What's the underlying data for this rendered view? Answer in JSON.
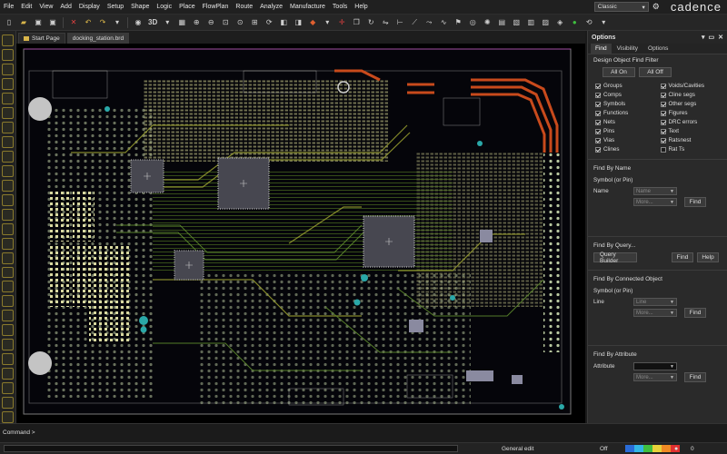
{
  "menubar": {
    "items": [
      "File",
      "Edit",
      "View",
      "Add",
      "Display",
      "Setup",
      "Shape",
      "Logic",
      "Place",
      "FlowPlan",
      "Route",
      "Analyze",
      "Manufacture",
      "Tools",
      "Help"
    ],
    "workspace": "Classic",
    "logo": "cadence"
  },
  "toolbar": {
    "view3d_label": "3D"
  },
  "tabs": [
    {
      "label": "Start Page"
    },
    {
      "label": "docking_station.brd"
    }
  ],
  "options": {
    "title": "Options",
    "tabs": [
      "Find",
      "Visibility",
      "Options"
    ],
    "filter": {
      "title": "Design Object Find Filter",
      "all_on": "All On",
      "all_off": "All Off",
      "left": [
        {
          "label": "Groups",
          "checked": true
        },
        {
          "label": "Comps",
          "checked": true
        },
        {
          "label": "Symbols",
          "checked": true
        },
        {
          "label": "Functions",
          "checked": true
        },
        {
          "label": "Nets",
          "checked": true
        },
        {
          "label": "Pins",
          "checked": true
        },
        {
          "label": "Vias",
          "checked": true
        },
        {
          "label": "Clines",
          "checked": true
        }
      ],
      "right": [
        {
          "label": "Voids/Cavities",
          "checked": true
        },
        {
          "label": "Cline segs",
          "checked": true
        },
        {
          "label": "Other segs",
          "checked": true
        },
        {
          "label": "Figures",
          "checked": true
        },
        {
          "label": "DRC errors",
          "checked": true
        },
        {
          "label": "Text",
          "checked": true
        },
        {
          "label": "Ratsnest",
          "checked": true
        },
        {
          "label": "Rat Ts",
          "checked": false
        }
      ]
    },
    "find_by_name": {
      "title": "Find By Name",
      "symbol_or_pin": "Symbol (or Pin)",
      "name_label": "Name",
      "name_value": "Name",
      "more_label": "More...",
      "find_button": "Find"
    },
    "find_by_query": {
      "title": "Find By Query...",
      "query_builder": "Query Builder",
      "find_button": "Find",
      "help_button": "Help"
    },
    "find_by_connected": {
      "title": "Find By Connected Object",
      "symbol_or_pin": "Symbol (or Pin)",
      "line_label": "Line",
      "line_value": "Line",
      "more_label": "More...",
      "find_button": "Find"
    },
    "find_by_attribute": {
      "title": "Find By Attribute",
      "attribute_label": "Attribute",
      "more_label": "More...",
      "find_button": "Find"
    }
  },
  "command": {
    "prompt": "Command >"
  },
  "status": {
    "mode": "General edit",
    "state": "Off",
    "zoom_value": "0",
    "colors": [
      "#2a6cd8",
      "#33b5e5",
      "#3fbf3f",
      "#e8d23a",
      "#f08a24",
      "#e03030"
    ]
  }
}
